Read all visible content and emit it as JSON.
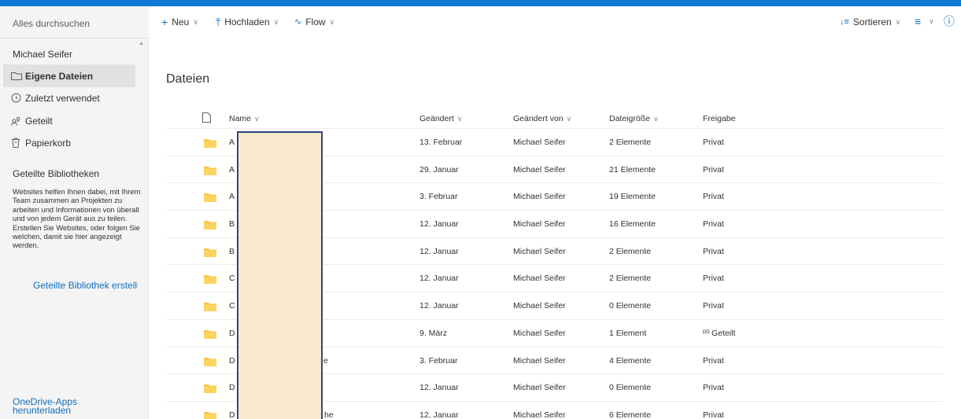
{
  "search": {
    "placeholder": "Alles durchsuchen"
  },
  "sidebar": {
    "user": "Michael Seifer",
    "items": [
      {
        "label": "Eigene Dateien",
        "icon": "folder-icon",
        "active": true
      },
      {
        "label": "Zuletzt verwendet",
        "icon": "history-icon"
      },
      {
        "label": "Geteilt",
        "icon": "shared-people-icon"
      },
      {
        "label": "Papierkorb",
        "icon": "recycle-bin-icon"
      }
    ],
    "libraries_heading": "Geteilte Bibliotheken",
    "libraries_desc": "Websites helfen Ihnen dabei, mit Ihrem Team zusammen an Projekten zu arbeiten und Informationen von überall und von jedem Gerät aus zu teilen. Erstellen Sie Websites, oder folgen Sie welchen, damit sie hier angezeigt werden.",
    "create_library": "Geteilte Bibliothek erstellen",
    "apps_link": "OneDrive-Apps herunterladen"
  },
  "toolbar": {
    "new_label": "Neu",
    "upload_label": "Hochladen",
    "flow_label": "Flow",
    "sort_label": "Sortieren"
  },
  "main": {
    "title": "Dateien",
    "columns": {
      "name": "Name",
      "modified": "Geändert",
      "modified_by": "Geändert von",
      "size": "Dateigröße",
      "sharing": "Freigabe"
    },
    "rows": [
      {
        "name": "A",
        "modified": "13. Februar",
        "modified_by": "Michael Seifer",
        "size": "2 Elemente",
        "sharing": "Privat"
      },
      {
        "name": "A",
        "modified": "29. Januar",
        "modified_by": "Michael Seifer",
        "size": "21 Elemente",
        "sharing": "Privat"
      },
      {
        "name": "A",
        "modified": "3. Februar",
        "modified_by": "Michael Seifer",
        "size": "19 Elemente",
        "sharing": "Privat"
      },
      {
        "name": "B",
        "modified": "12. Januar",
        "modified_by": "Michael Seifer",
        "size": "16 Elemente",
        "sharing": "Privat"
      },
      {
        "name": "B",
        "modified": "12. Januar",
        "modified_by": "Michael Seifer",
        "size": "2 Elemente",
        "sharing": "Privat"
      },
      {
        "name": "C",
        "modified": "12. Januar",
        "modified_by": "Michael Seifer",
        "size": "2 Elemente",
        "sharing": "Privat"
      },
      {
        "name": "C",
        "modified": "12. Januar",
        "modified_by": "Michael Seifer",
        "size": "0 Elemente",
        "sharing": "Privat"
      },
      {
        "name": "D",
        "modified": "9. März",
        "modified_by": "Michael Seifer",
        "size": "1 Element",
        "sharing": "Geteilt"
      },
      {
        "name": "D",
        "modified": "3. Februar",
        "modified_by": "Michael Seifer",
        "size": "4 Elemente",
        "sharing": "Privat",
        "name_tail": "e"
      },
      {
        "name": "D",
        "modified": "12. Januar",
        "modified_by": "Michael Seifer",
        "size": "0 Elemente",
        "sharing": "Privat"
      },
      {
        "name": "D",
        "modified": "12. Januar",
        "modified_by": "Michael Seifer",
        "size": "6 Elemente",
        "sharing": "Privat",
        "name_tail": "he"
      }
    ]
  }
}
